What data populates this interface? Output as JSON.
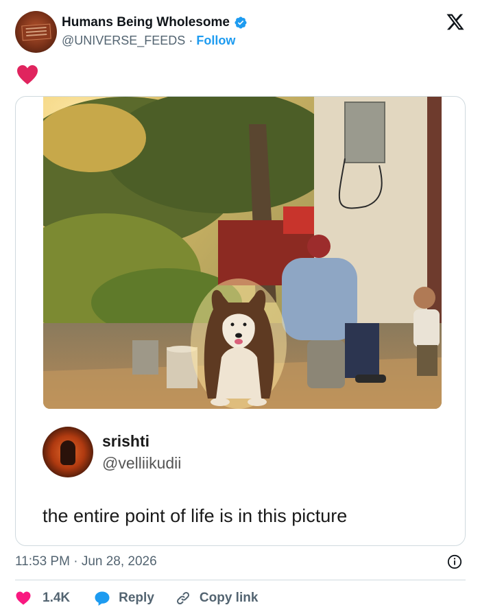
{
  "author": {
    "name": "Humans Being Wholesome",
    "handle": "@UNIVERSE_FEEDS",
    "separator": "·",
    "follow_label": "Follow",
    "verified_icon": "verified-badge-icon",
    "verified_color": "#1d9bf0"
  },
  "brand_icon": "x-logo-icon",
  "reaction_icon": "heart-icon",
  "quoted_post": {
    "name": "srishti",
    "handle": "@velliikudii",
    "text": "the entire point of life is in this picture"
  },
  "meta": {
    "time": "11:53 PM",
    "separator": "·",
    "date": "Jun 28, 2026"
  },
  "actions": {
    "like_count": "1.4K",
    "reply_label": "Reply",
    "copy_link_label": "Copy link"
  },
  "colors": {
    "accent": "#1d9bf0",
    "heart": "#f91880",
    "text_secondary": "#536471",
    "border": "#cfd9de"
  }
}
